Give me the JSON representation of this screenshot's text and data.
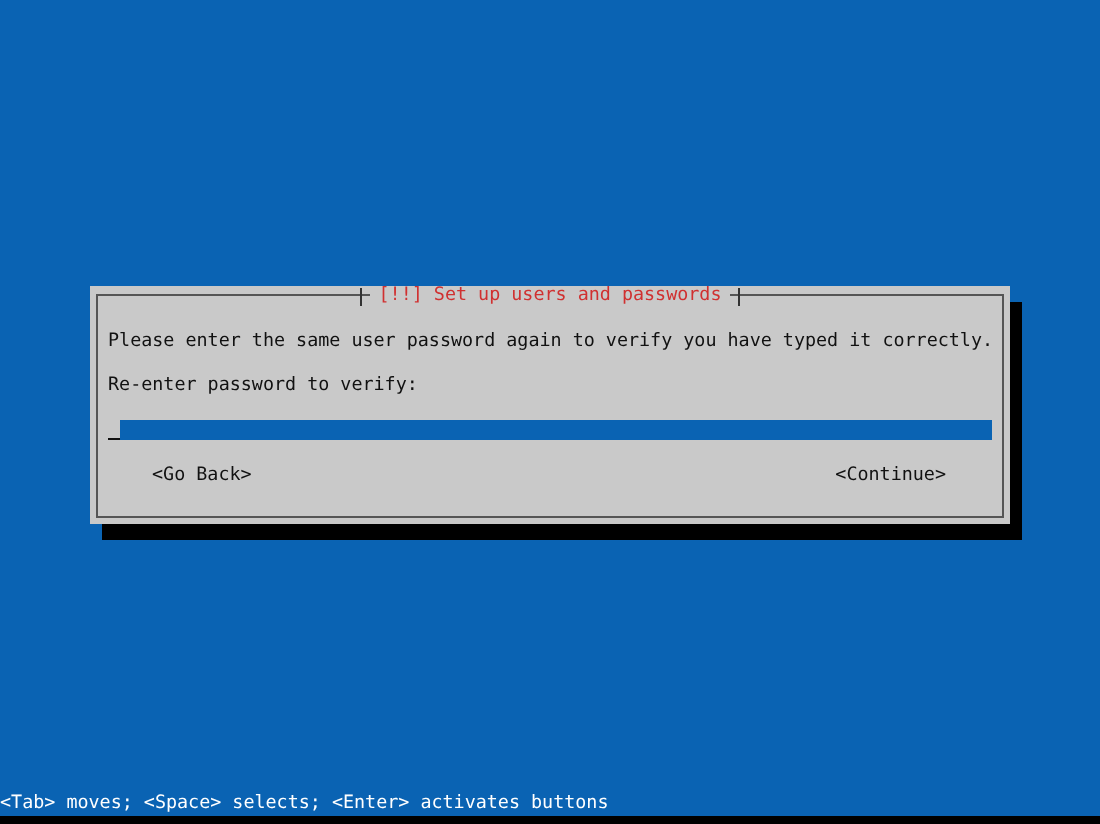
{
  "dialog": {
    "title": "[!!] Set up users and passwords",
    "message": "Please enter the same user password again to verify you have typed it correctly.",
    "field_label": "Re-enter password to verify:",
    "buttons": [
      "<Go Back>",
      "<Continue>"
    ]
  },
  "status_bar": "<Tab> moves; <Space> selects; <Enter> activates buttons"
}
